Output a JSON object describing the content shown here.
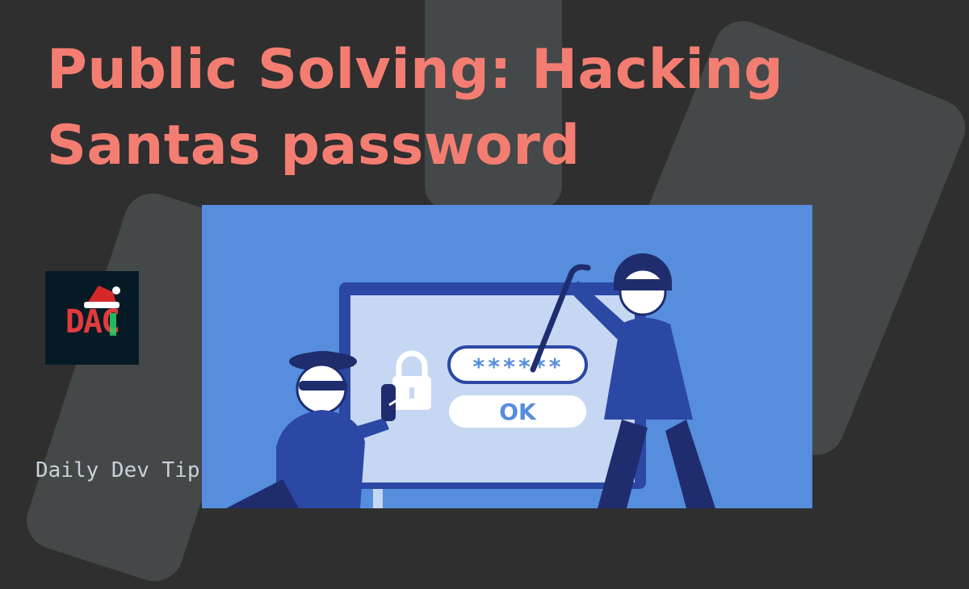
{
  "header": {
    "title_line1": "Public Solving: Hacking",
    "title_line2": "Santas password"
  },
  "logo": {
    "text": "DAC",
    "icon": "santa-hat-icon"
  },
  "brand": {
    "name": "Daily Dev Tips"
  },
  "illustration": {
    "password_mask": "******",
    "ok_label": "OK",
    "icons": [
      "padlock-icon",
      "crowbar-icon"
    ]
  },
  "colors": {
    "background": "#2f2f2f",
    "shape": "#454849",
    "title": "#f47d72",
    "illustration_bg": "#568ddc",
    "screen": "#c5d7f2",
    "navy": "#1f2d6e",
    "logo_bg": "#061a26"
  }
}
